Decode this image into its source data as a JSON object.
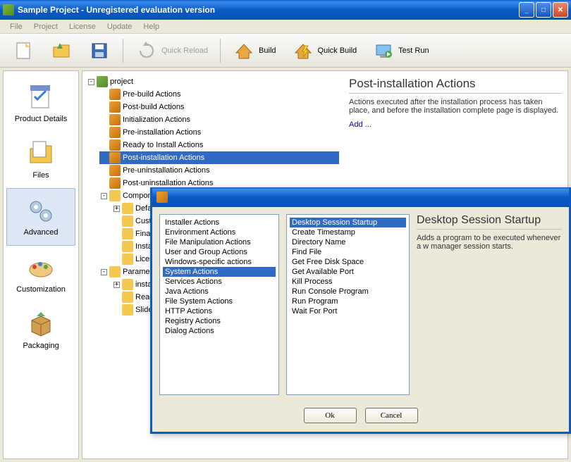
{
  "window": {
    "title": "Sample Project - Unregistered evaluation version"
  },
  "menu": [
    "File",
    "Project",
    "License",
    "Update",
    "Help"
  ],
  "toolbar": {
    "reload_label": "Quick Reload",
    "build_label": "Build",
    "qbuild_label": "Quick Build",
    "testrun_label": "Test Run"
  },
  "sidebar": {
    "items": [
      {
        "label": "Product Details"
      },
      {
        "label": "Files"
      },
      {
        "label": "Advanced"
      },
      {
        "label": "Customization"
      },
      {
        "label": "Packaging"
      }
    ]
  },
  "tree": {
    "root": "project",
    "nodes": [
      "Pre-build Actions",
      "Post-build Actions",
      "Initialization Actions",
      "Pre-installation Actions",
      "Ready to Install Actions",
      "Post-installation Actions",
      "Pre-uninstallation Actions",
      "Post-uninstallation Actions"
    ],
    "components": "Compone",
    "comp_children": [
      "Defa",
      "Custom",
      "Final Pa",
      "Installat",
      "License"
    ],
    "params": "Parame",
    "params_children": [
      "install",
      "Readme",
      "Slidesho"
    ]
  },
  "detail": {
    "title": "Post-installation Actions",
    "desc": "Actions executed after the installation process has taken place, and before the installation complete page is displayed.",
    "add": "Add ..."
  },
  "dialog": {
    "categories": [
      "Installer Actions",
      "Environment Actions",
      "File Manipulation Actions",
      "User and Group Actions",
      "Windows-specific actions",
      "System Actions",
      "Services Actions",
      "Java Actions",
      "File System Actions",
      "HTTP Actions",
      "Registry Actions",
      "Dialog Actions"
    ],
    "actions": [
      "Desktop Session Startup",
      "Create Timestamp",
      "Directory Name",
      "Find File",
      "Get Free Disk Space",
      "Get Available Port",
      "Kill Process",
      "Run Console Program",
      "Run Program",
      "Wait For Port"
    ],
    "detail_title": "Desktop Session Startup",
    "detail_desc": "Adds a program to be executed whenever a w manager session starts.",
    "ok": "Ok",
    "cancel": "Cancel"
  }
}
